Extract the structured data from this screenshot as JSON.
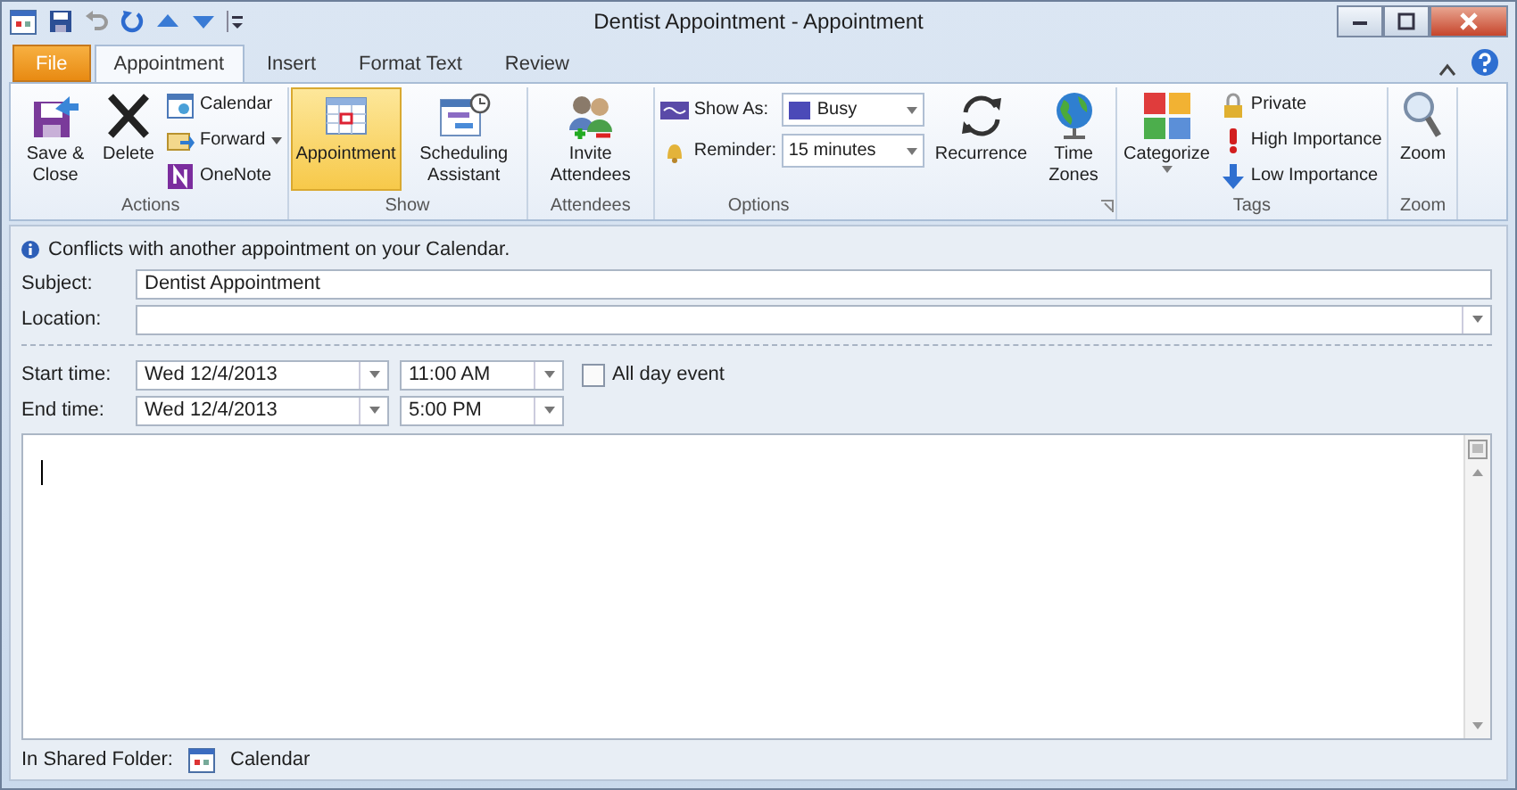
{
  "window": {
    "title": "Dentist Appointment - Appointment"
  },
  "tabs": [
    {
      "label": "File",
      "kind": "file",
      "selected": false
    },
    {
      "label": "Appointment",
      "kind": "tab",
      "selected": true
    },
    {
      "label": "Insert",
      "kind": "tab",
      "selected": false
    },
    {
      "label": "Format Text",
      "kind": "tab",
      "selected": false
    },
    {
      "label": "Review",
      "kind": "tab",
      "selected": false
    }
  ],
  "ribbon": {
    "actions": {
      "label": "Actions",
      "save": "Save & Close",
      "delete": "Delete",
      "calendar": "Calendar",
      "forward": "Forward",
      "onenote": "OneNote"
    },
    "show": {
      "label": "Show",
      "buttons": [
        {
          "label": "Appointment",
          "selected": true
        },
        {
          "label": "Scheduling Assistant",
          "selected": false
        }
      ]
    },
    "attendees": {
      "label": "Attendees",
      "invite": "Invite Attendees"
    },
    "options": {
      "label": "Options",
      "show_as_label": "Show As:",
      "show_as": "Busy",
      "reminder_label": "Reminder:",
      "reminder": "15 minutes",
      "recurrence": "Recurrence",
      "time_zones": "Time Zones"
    },
    "tags": {
      "label": "Tags",
      "categorize": "Categorize",
      "private": "Private",
      "high": "High Importance",
      "low": "Low Importance"
    },
    "zoom": {
      "label": "Zoom",
      "zoom": "Zoom"
    }
  },
  "info": "Conflicts with another appointment on your Calendar.",
  "form": {
    "subject_label": "Subject:",
    "subject": "Dentist Appointment",
    "location_label": "Location:",
    "start_label": "Start time:",
    "start_date": "Wed 12/4/2013",
    "start_time": "11:00 AM",
    "all_day_label": "All day event",
    "all_day": false,
    "end_label": "End time:",
    "end_date": "Wed 12/4/2013",
    "end_time": "5:00 PM"
  },
  "footer": {
    "label": "In Shared Folder:",
    "folder": "Calendar"
  }
}
